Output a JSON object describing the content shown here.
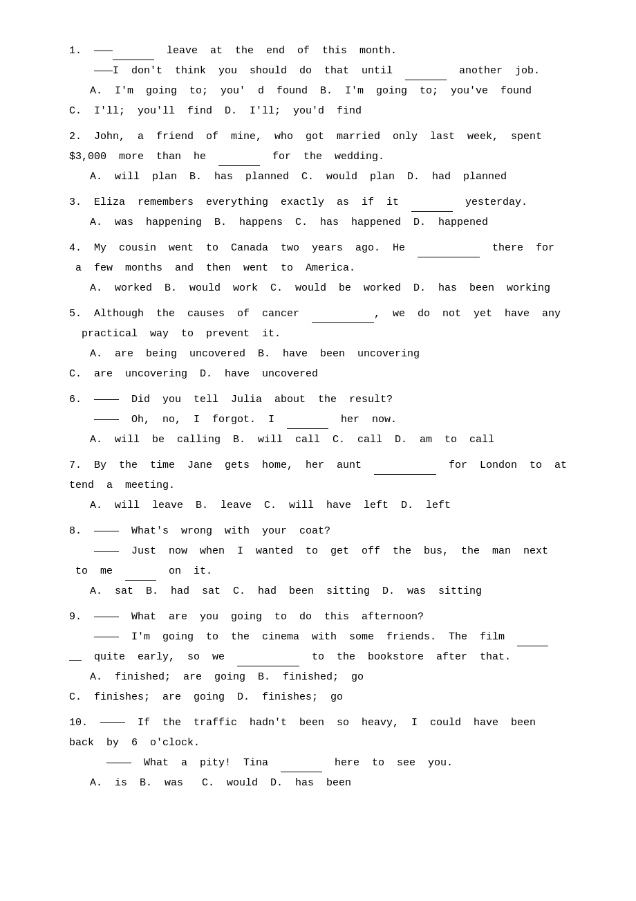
{
  "questions": [
    {
      "number": "1.",
      "lines": [
        "1.  ———<span class='blank'></span>  leave  at  the  end  of  this  month.",
        "    ———I  don't  think  you  should  do  that  until  <span class='blank'></span>  another  job.",
        "    A.  I'm  going  to;  you'd  found  B.  I'm  going  to;  you've  found",
        "C.  I'll;  you'll  find  D.  I'll;  you'd  find"
      ]
    }
  ]
}
